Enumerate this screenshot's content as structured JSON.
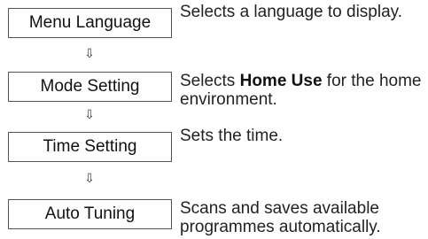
{
  "steps": [
    {
      "label": "Menu Language",
      "description": "Selects a language to display."
    },
    {
      "label": "Mode Setting",
      "description_prefix": "Selects ",
      "description_bold": "Home Use",
      "description_suffix": " for the home environment."
    },
    {
      "label": "Time Setting",
      "description": "Sets the time."
    },
    {
      "label": "Auto Tuning",
      "description": "Scans and saves available programmes automatically."
    }
  ],
  "arrow_glyph": "⇩"
}
